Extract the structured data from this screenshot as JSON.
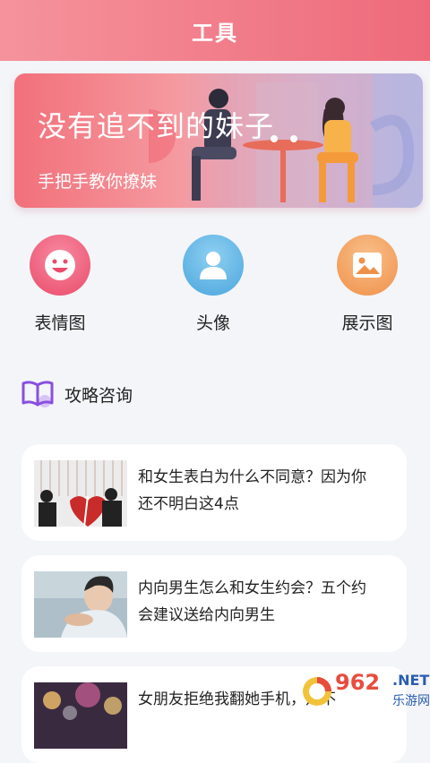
{
  "header": {
    "title": "工具"
  },
  "banner": {
    "title": "没有追不到的妹子",
    "subtitle": "手把手教你撩妹"
  },
  "tools": [
    {
      "label": "表情图",
      "icon": "smiley-icon",
      "color": "#ef5a75"
    },
    {
      "label": "头像",
      "icon": "user-icon",
      "color": "#5cb0e0"
    },
    {
      "label": "展示图",
      "icon": "picture-icon",
      "color": "#f39a5a"
    }
  ],
  "section": {
    "title": "攻略咨询",
    "icon": "book-icon"
  },
  "articles": [
    {
      "title": "和女生表白为什么不同意？因为你还不明白这4点"
    },
    {
      "title": "内向男生怎么和女生约会？五个约会建议送给内向男生"
    },
    {
      "title": "女朋友拒绝我翻她手机，是不"
    }
  ],
  "watermark": {
    "number": "962",
    "suffix": ".NET",
    "site": "乐游网"
  }
}
